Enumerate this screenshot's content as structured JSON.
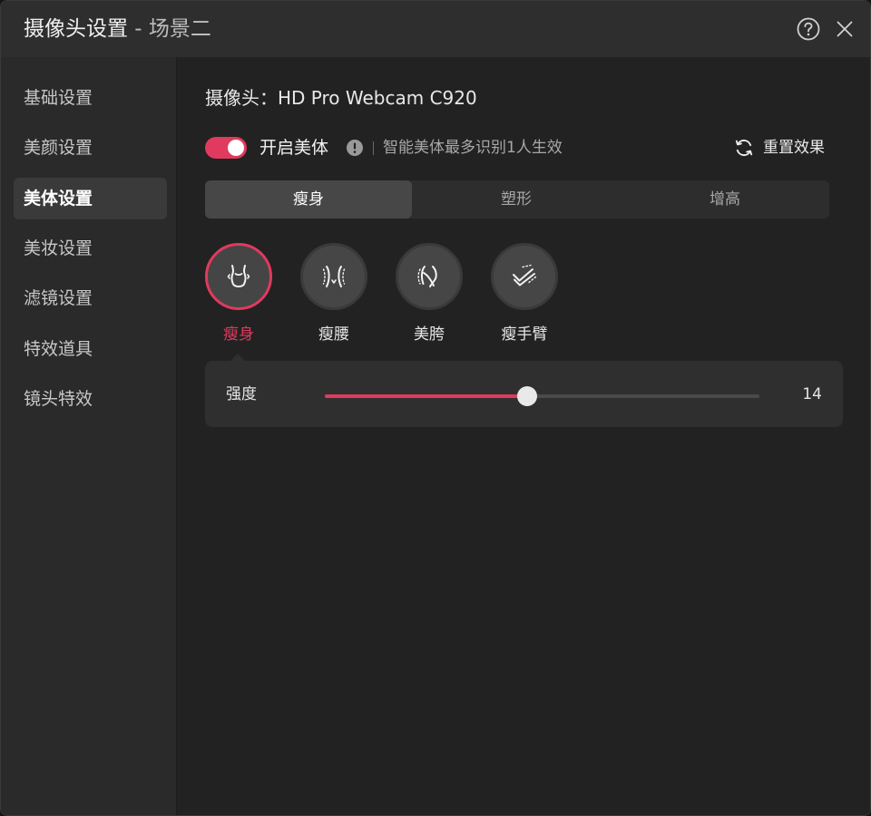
{
  "window": {
    "title": "摄像头设置",
    "subtitle": " - 场景二",
    "help_icon": "help-circle-icon",
    "close_icon": "close-icon"
  },
  "sidebar": {
    "items": [
      {
        "label": "基础设置",
        "active": false
      },
      {
        "label": "美颜设置",
        "active": false
      },
      {
        "label": "美体设置",
        "active": true
      },
      {
        "label": "美妆设置",
        "active": false
      },
      {
        "label": "滤镜设置",
        "active": false
      },
      {
        "label": "特效道具",
        "active": false
      },
      {
        "label": "镜头特效",
        "active": false
      }
    ]
  },
  "main": {
    "camera_label": "摄像头：",
    "camera_name": "HD Pro Webcam C920",
    "enable": {
      "label": "开启美体",
      "on": true
    },
    "hint": "智能美体最多识别1人生效",
    "reset_label": "重置效果",
    "tabs": [
      {
        "label": "瘦身",
        "active": true
      },
      {
        "label": "塑形",
        "active": false
      },
      {
        "label": "增高",
        "active": false
      }
    ],
    "effects": [
      {
        "label": "瘦身",
        "icon": "body-slim-icon",
        "active": true
      },
      {
        "label": "瘦腰",
        "icon": "waist-slim-icon",
        "active": false
      },
      {
        "label": "美胯",
        "icon": "hip-shape-icon",
        "active": false
      },
      {
        "label": "瘦手臂",
        "icon": "arm-slim-icon",
        "active": false
      }
    ],
    "strength": {
      "label": "强度",
      "value": 14,
      "fraction": 0.465
    }
  },
  "colors": {
    "accent": "#e03a5e",
    "background": "#222222",
    "sidebar": "#2a2a2a",
    "titlebar": "#2e2e2e"
  }
}
